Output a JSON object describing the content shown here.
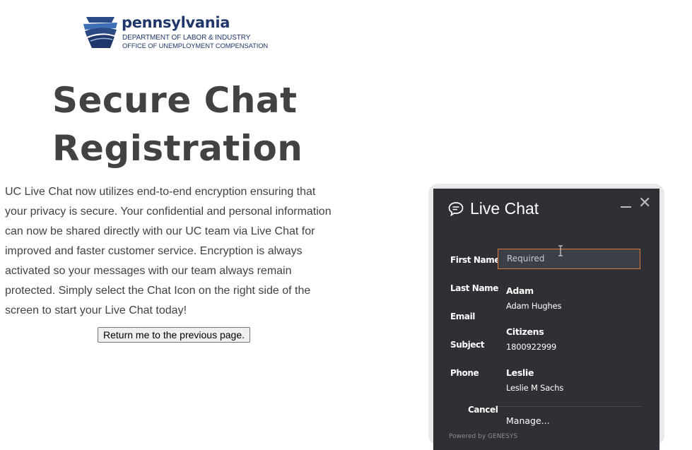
{
  "header": {
    "logo_title": "pennsylvania",
    "logo_line1": "DEPARTMENT OF LABOR & INDUSTRY",
    "logo_line2": "OFFICE OF UNEMPLOYMENT COMPENSATION",
    "brand_color": "#20376b"
  },
  "main": {
    "title_line1": "Secure Chat",
    "title_line2": "Registration",
    "intro": "UC Live Chat now utilizes end-to-end encryption ensuring that your privacy is secure. Your confidential and personal information can now be shared directly with our UC team via Live Chat for improved and faster customer service. Encryption is always activated so your messages with our team always remain protected. Simply select the Chat Icon on the right side of the screen to start your Live Chat today!",
    "return_button": "Return me to the previous page."
  },
  "chat": {
    "title": "Live Chat",
    "minimize_icon": "minimize-icon",
    "close_glyph": "✕",
    "labels": {
      "first_name": "First Name",
      "last_name": "Last Name",
      "email": "Email",
      "subject": "Subject",
      "phone": "Phone",
      "cancel": "Cancel"
    },
    "first_name_placeholder": "Required",
    "autocomplete": [
      {
        "main": "Adam",
        "sub": "Adam Hughes"
      },
      {
        "main": "Citizens",
        "sub": "1800922999"
      },
      {
        "main": "Leslie",
        "sub": "Leslie M Sachs"
      }
    ],
    "manage": "Manage...",
    "powered_by": "Powered by GENESYS",
    "accent_color": "#d9793a",
    "panel_color": "#2e3035"
  }
}
